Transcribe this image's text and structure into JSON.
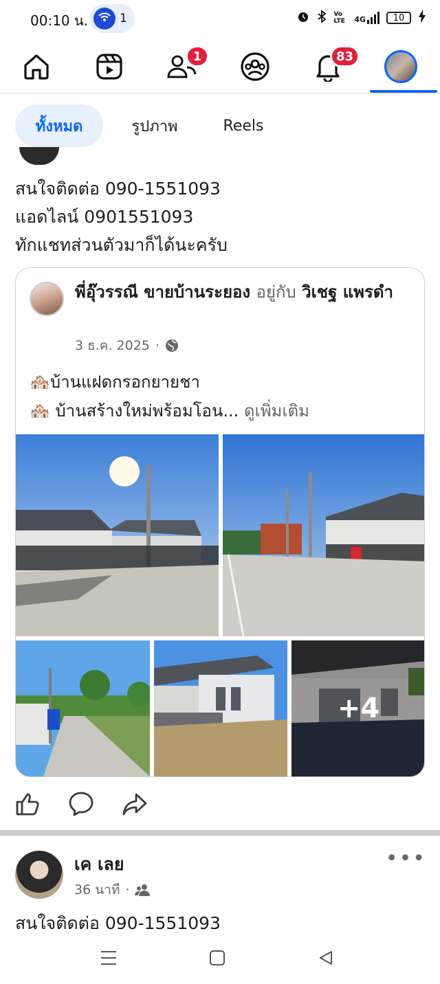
{
  "status_bar": {
    "time": "00:10 น.",
    "hotspot_count": "1",
    "network_label": "4G",
    "volte_label": "Vo LTE",
    "battery_level": "10"
  },
  "nav": {
    "friends_badge": "1",
    "notifications_badge": "83"
  },
  "filter_tabs": [
    {
      "label": "ทั้งหมด",
      "active": true
    },
    {
      "label": "รูปภาพ",
      "active": false
    },
    {
      "label": "Reels",
      "active": false
    }
  ],
  "post1": {
    "lines": [
      "สนใจติดต่อ 090-1551093",
      "แอดไลน์ 0901551093",
      "ทักแชทส่วนตัวมาก็ได้นะครับ"
    ]
  },
  "shared": {
    "author": "พี่อุ๊วรรณี ขายบ้านระยอง",
    "with_label": "อยู่กับ",
    "with_name": "วิเชฐ แพรดำ",
    "date": "3 ธ.ค. 2025",
    "line1": "🏘️บ้านแฝดกรอกยายชา",
    "line2": "🏘️  บ้านสร้างใหม่พร้อมโอน...",
    "see_more": "ดูเพิ่มเติม",
    "more_photos": "+4"
  },
  "post2": {
    "author": "เค เลย",
    "time": "36 นาที",
    "text": "สนใจติดต่อ 090-1551093"
  },
  "colors": {
    "accent": "#0866ff",
    "badge": "#e41e3f",
    "chip_bg": "#e7f0fd",
    "secondary_text": "#65676b"
  }
}
